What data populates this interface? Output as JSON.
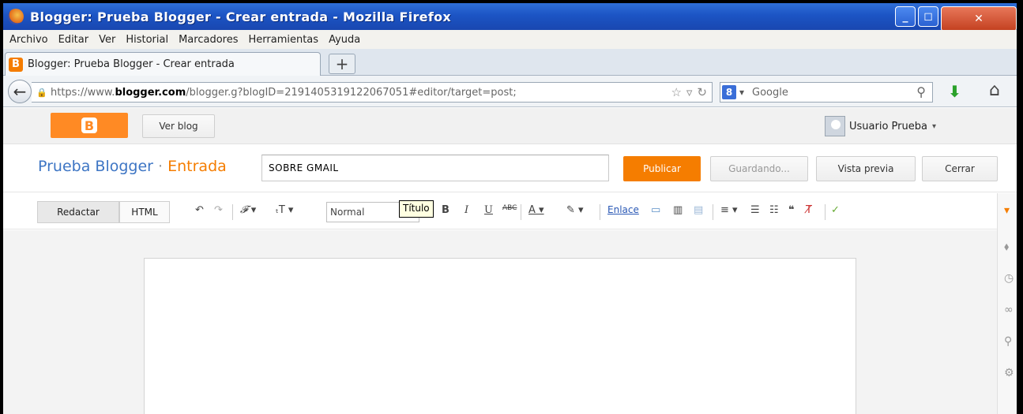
{
  "window": {
    "title": "Blogger: Prueba Blogger - Crear entrada - Mozilla Firefox",
    "minimize": "_",
    "maximize": "◻",
    "close": "✕"
  },
  "menu": [
    "Archivo",
    "Editar",
    "Ver",
    "Historial",
    "Marcadores",
    "Herramientas",
    "Ayuda"
  ],
  "tab": {
    "favicon": "B",
    "label": "Blogger: Prueba Blogger - Crear entrada",
    "new_tab": "+"
  },
  "navbar": {
    "url_prefix": "https://www.",
    "url_domain": "blogger.com",
    "url_rest": "/blogger.g?blogID=2191405319122067051#editor/target=post;",
    "search_engine_badge": "8",
    "search_placeholder": "Google"
  },
  "blogger": {
    "logo_letter": "B",
    "view_blog": "Ver blog",
    "user_name": "Usuario Prueba",
    "blog_name": "Prueba Blogger",
    "separator": "·",
    "section": "Entrada",
    "post_title": "SOBRE GMAIL",
    "publish": "Publicar",
    "saving": "Guardando...",
    "preview": "Vista previa",
    "close": "Cerrar"
  },
  "toolbar": {
    "compose": "Redactar",
    "html": "HTML",
    "format": "Normal",
    "tooltip": "Título",
    "link": "Enlace"
  },
  "colors": {
    "blogger_orange": "#f57d00",
    "blog_name_blue": "#3d75c4",
    "titlebar_blue": "#1c54c4"
  }
}
